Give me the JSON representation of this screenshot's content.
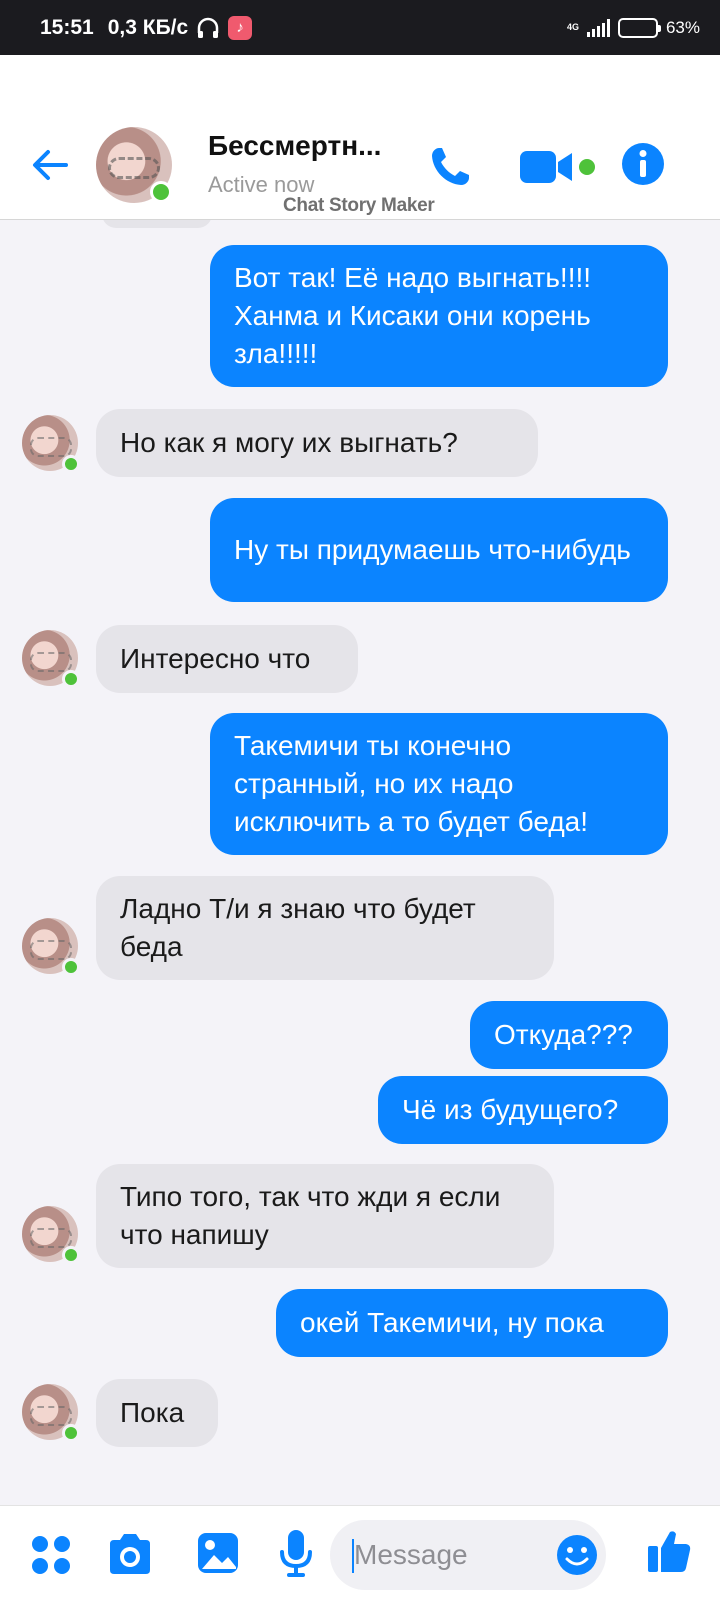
{
  "status_bar": {
    "time": "15:51",
    "speed": "0,3 КБ/с",
    "network": "4G",
    "battery": "63%",
    "battery_level": 0.63
  },
  "header": {
    "name": "Бессмертн...",
    "status": "Active now",
    "watermark": "Chat Story Maker",
    "accent": "#0b84ff",
    "online_color": "#4ec23a"
  },
  "messages": [
    {
      "side": "out",
      "text": "Вот так! Её надо выгнать!!!! Ханма и Кисаки они корень зла!!!!!"
    },
    {
      "side": "in",
      "text": "Но как я могу  их выгнать?"
    },
    {
      "side": "out",
      "text": "Ну ты придумаешь что-нибудь"
    },
    {
      "side": "in",
      "text": "Интересно что"
    },
    {
      "side": "out",
      "text": "Такемичи ты конечно странный, но их надо исключить а то будет беда!"
    },
    {
      "side": "in",
      "text": "Ладно Т/и я знаю что будет беда"
    },
    {
      "side": "out",
      "text": "Откуда???"
    },
    {
      "side": "out",
      "text": "Чё из будущего?"
    },
    {
      "side": "in",
      "text": "Типо того, так что жди я если что напишу"
    },
    {
      "side": "out",
      "text": "окей Такемичи, ну пока"
    },
    {
      "side": "in",
      "text": "Пока"
    }
  ],
  "composer": {
    "placeholder": "Message",
    "icons": [
      "menu-icon",
      "camera-icon",
      "gallery-icon",
      "mic-icon",
      "emoji-icon",
      "like-icon"
    ]
  }
}
